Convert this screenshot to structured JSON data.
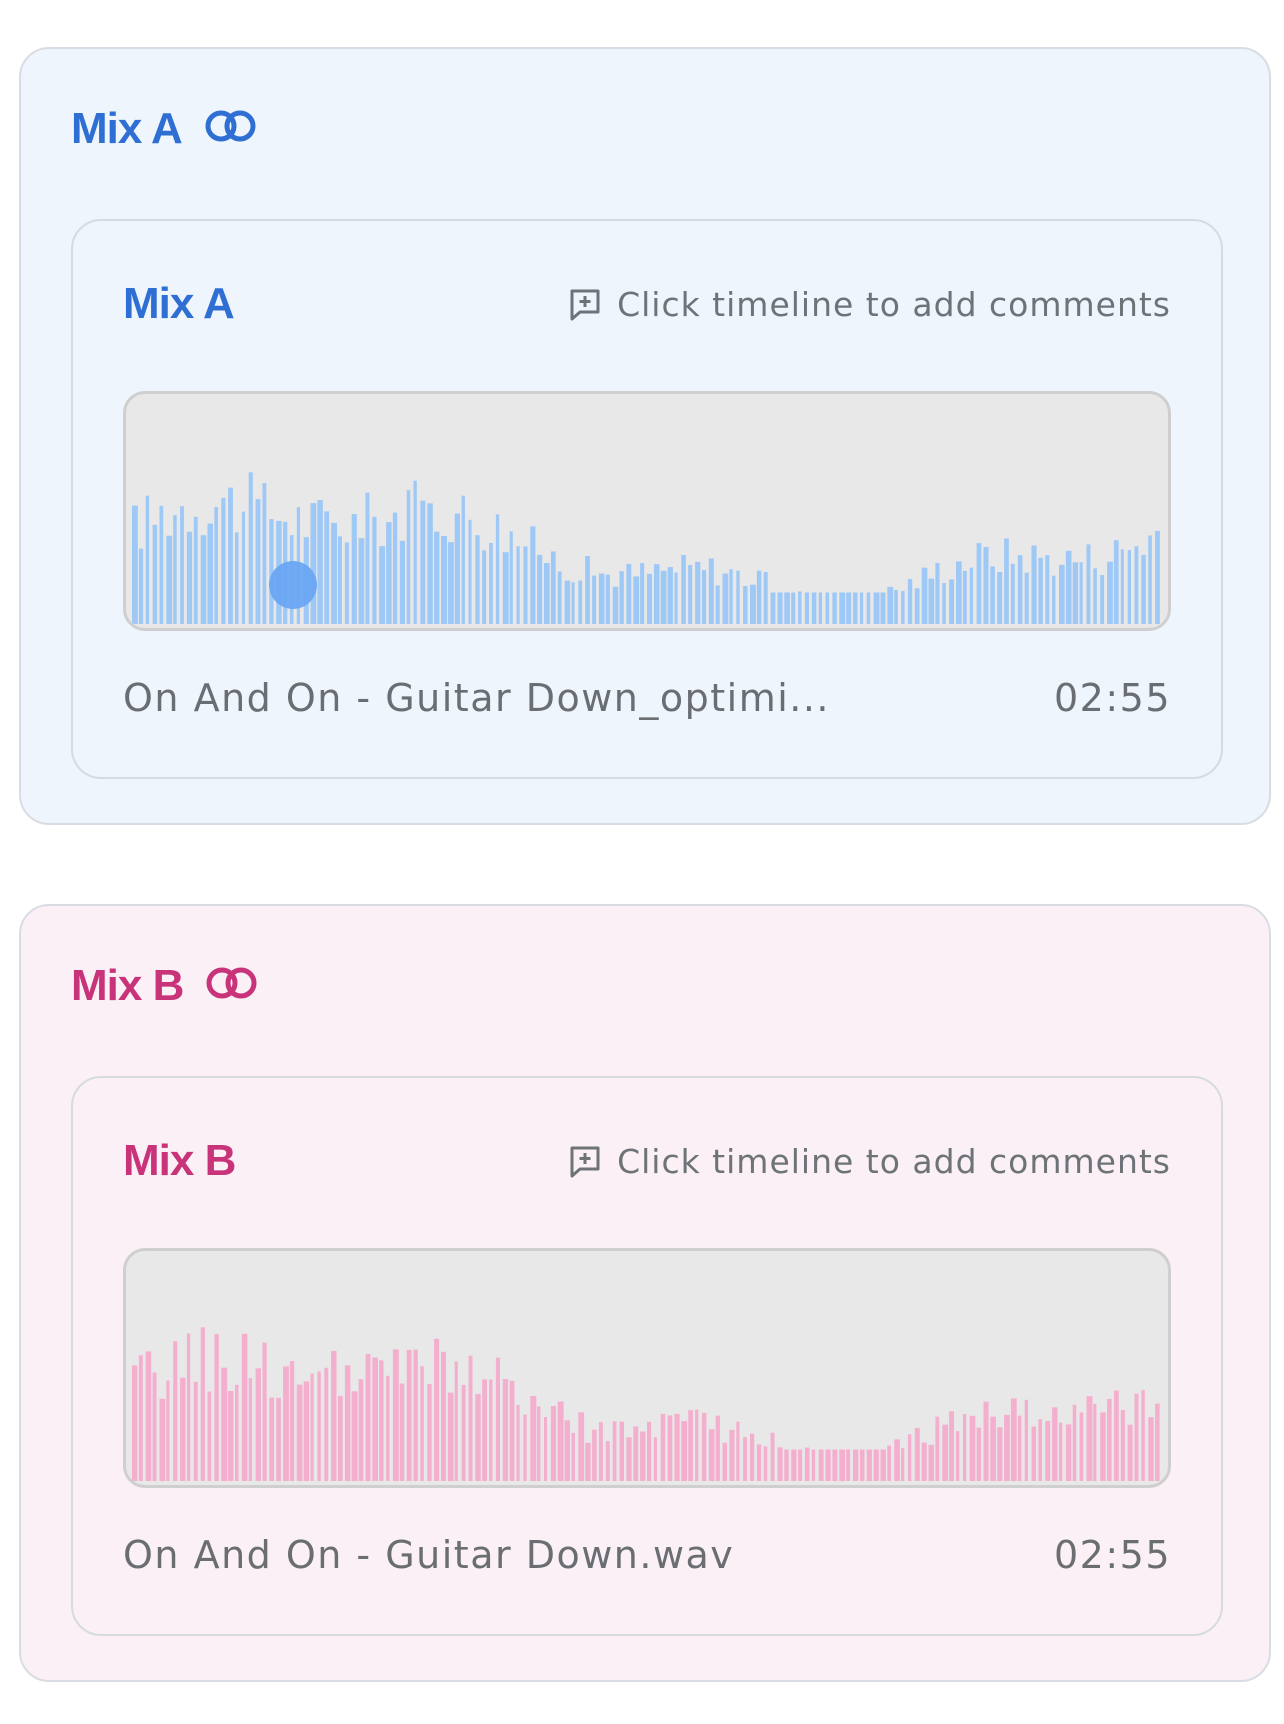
{
  "mixes": [
    {
      "group_label": "Mix A",
      "group_icon": "linked-rings-icon",
      "player_title": "Mix A",
      "hint_text": "Click timeline to add comments",
      "hint_icon": "comment-plus-icon",
      "file_name": "On And On - Guitar Down_optimi...",
      "duration": "02:55",
      "accent": "#2f6fd3",
      "wave_color": "#9ec8f5",
      "playhead_progress": 0.16
    },
    {
      "group_label": "Mix B",
      "group_icon": "linked-rings-icon",
      "player_title": "Mix B",
      "hint_text": "Click timeline to add comments",
      "hint_icon": "comment-plus-icon",
      "file_name": "On And On - Guitar Down.wav",
      "duration": "02:55",
      "accent": "#c8337a",
      "wave_color": "#f4afcf",
      "playhead_progress": null
    }
  ]
}
